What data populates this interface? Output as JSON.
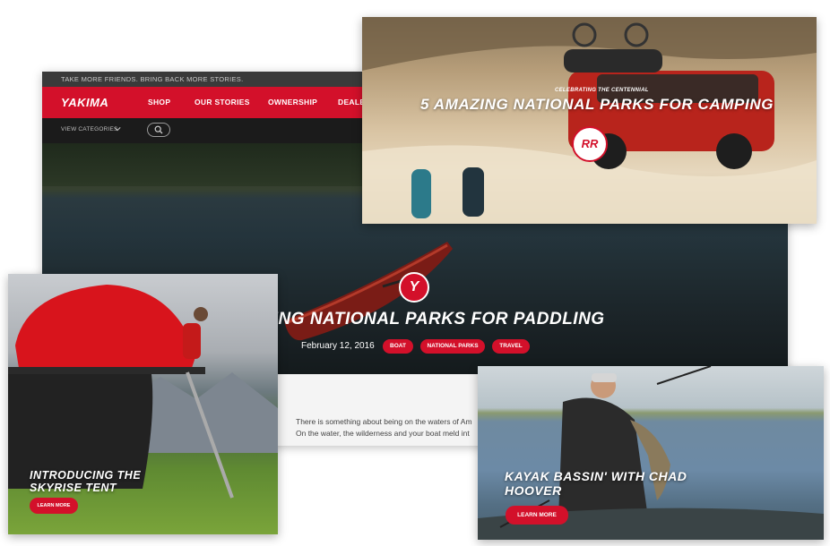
{
  "site": {
    "announcement": "TAKE MORE FRIENDS. BRING BACK MORE STORIES.",
    "logo": "YAKIMA",
    "nav": [
      "SHOP",
      "OUR STORIES",
      "OWNERSHIP",
      "DEALE"
    ],
    "view_categories": "VIEW CATEGORIES",
    "icons": {
      "chevron": "chevron-down-icon",
      "search": "search-icon"
    },
    "brand_red": "#d3102a"
  },
  "hero": {
    "badge": "Y",
    "title": "TANDING NATIONAL PARKS FOR PADDLING",
    "date": "February 12, 2016",
    "tags": [
      "BOAT",
      "NATIONAL PARKS",
      "TRAVEL"
    ]
  },
  "article": {
    "line1": "There is something about being on the waters of Am",
    "line2": "On the water, the wilderness and your boat meld int"
  },
  "cards": {
    "camping": {
      "eyebrow": "CELEBRATING THE CENTENNIAL",
      "title": "5 AMAZING NATIONAL PARKS FOR CAMPING",
      "logo": "RR"
    },
    "skyrise": {
      "title_line1": "INTRODUCING THE",
      "title_line2": "SKYRISE TENT",
      "button": "LEARN MORE"
    },
    "kayak": {
      "title_line1": "KAYAK BASSIN' WITH CHAD",
      "title_line2": "HOOVER",
      "button": "LEARN MORE"
    }
  }
}
